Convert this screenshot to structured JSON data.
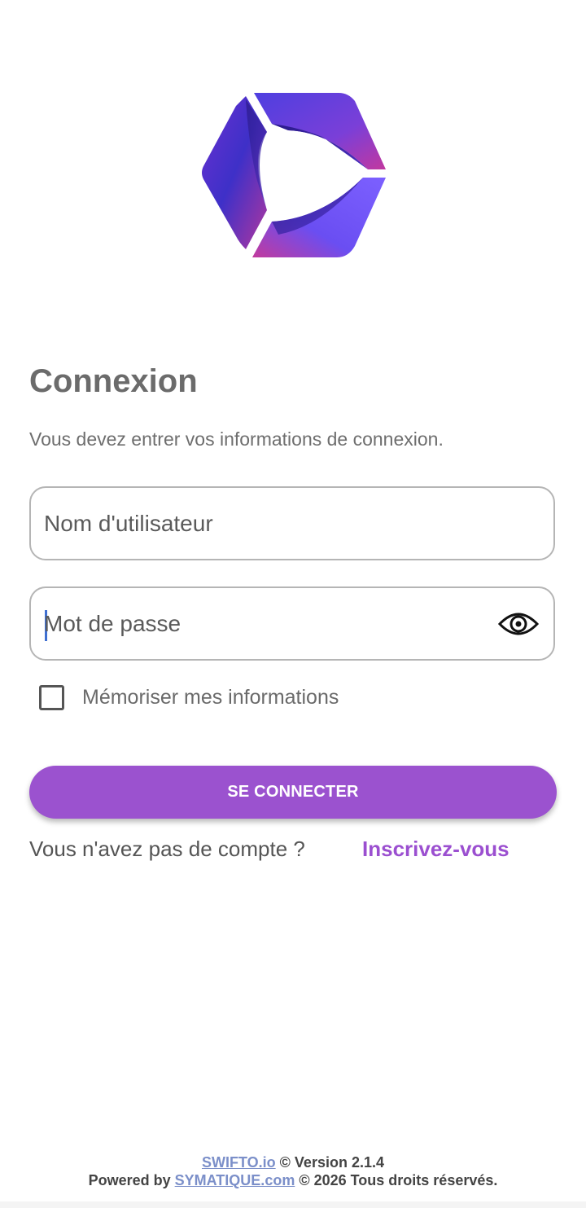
{
  "login": {
    "title": "Connexion",
    "subtitle": "Vous devez entrer vos informations de connexion.",
    "username_placeholder": "Nom d'utilisateur",
    "password_placeholder": "Mot de passe",
    "remember_label": "Mémoriser mes informations",
    "remember_checked": false,
    "submit_label": "SE CONNECTER",
    "no_account_text": "Vous n'avez pas de compte ?",
    "signup_link": "Inscrivez-vous"
  },
  "footer": {
    "brand_link": "SWIFTO.io",
    "version_text": " © Version 2.1.4",
    "powered_prefix": "Powered by ",
    "company_link": "SYMATIQUE.com",
    "rights_text": " © 2026 Tous droits réservés."
  },
  "icons": {
    "logo": "hexagon-logo",
    "password_toggle": "eye-icon"
  },
  "colors": {
    "accent": "#9b52cf",
    "link": "#9b4fd0",
    "footer_link": "#7b8fc9",
    "logo_blue": "#4a3bd6",
    "logo_magenta": "#b03aa8"
  }
}
